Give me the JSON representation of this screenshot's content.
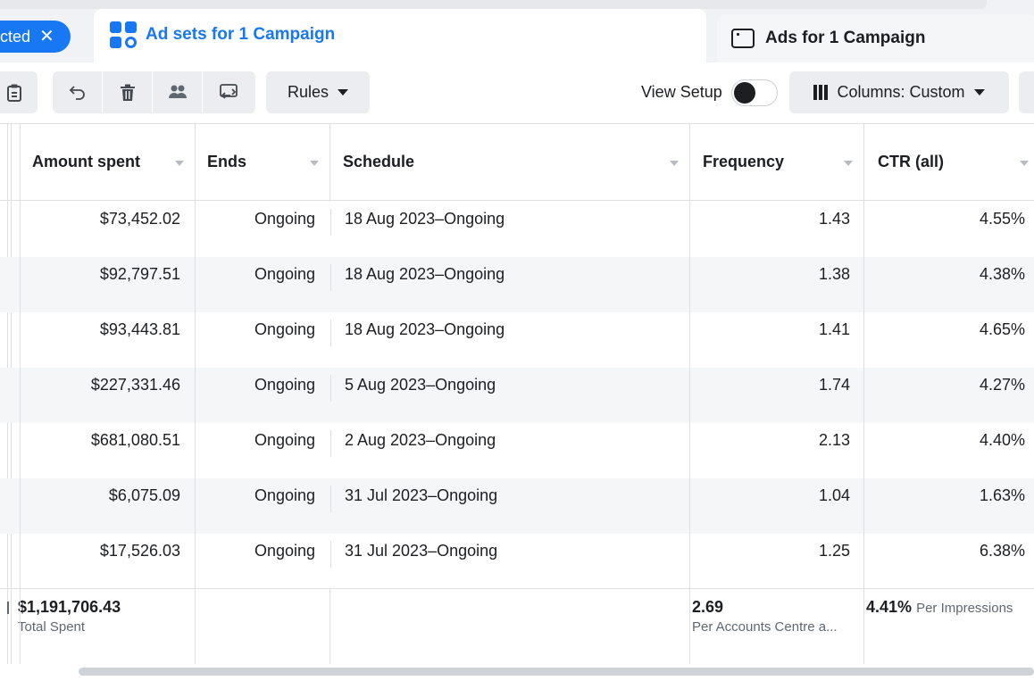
{
  "tabs": {
    "selected_pill": "cted",
    "active": "Ad sets for 1 Campaign",
    "inactive": "Ads for 1 Campaign"
  },
  "toolbar": {
    "rules_label": "Rules",
    "view_setup_label": "View Setup",
    "columns_label": "Columns: Custom"
  },
  "table": {
    "headers": {
      "amount_spent": "Amount spent",
      "ends": "Ends",
      "schedule": "Schedule",
      "frequency": "Frequency",
      "ctr": "CTR (all)"
    },
    "rows": [
      {
        "amount": "$73,452.02",
        "ends": "Ongoing",
        "schedule": "18 Aug 2023–Ongoing",
        "frequency": "1.43",
        "ctr": "4.55%"
      },
      {
        "amount": "$92,797.51",
        "ends": "Ongoing",
        "schedule": "18 Aug 2023–Ongoing",
        "frequency": "1.38",
        "ctr": "4.38%"
      },
      {
        "amount": "$93,443.81",
        "ends": "Ongoing",
        "schedule": "18 Aug 2023–Ongoing",
        "frequency": "1.41",
        "ctr": "4.65%"
      },
      {
        "amount": "$227,331.46",
        "ends": "Ongoing",
        "schedule": "5 Aug 2023–Ongoing",
        "frequency": "1.74",
        "ctr": "4.27%"
      },
      {
        "amount": "$681,080.51",
        "ends": "Ongoing",
        "schedule": "2 Aug 2023–Ongoing",
        "frequency": "2.13",
        "ctr": "4.40%"
      },
      {
        "amount": "$6,075.09",
        "ends": "Ongoing",
        "schedule": "31 Jul 2023–Ongoing",
        "frequency": "1.04",
        "ctr": "1.63%"
      },
      {
        "amount": "$17,526.03",
        "ends": "Ongoing",
        "schedule": "31 Jul 2023–Ongoing",
        "frequency": "1.25",
        "ctr": "6.38%"
      }
    ],
    "totals": {
      "amount": "$1,191,706.43",
      "amount_sub": "Total Spent",
      "frequency": "2.69",
      "frequency_sub": "Per Accounts Centre a...",
      "ctr": "4.41%",
      "ctr_sub": "Per Impressions"
    }
  },
  "colors": {
    "accent": "#1877f2",
    "button_bg": "#ebedf0",
    "row_alt": "#f5f6f7",
    "border": "#dddfe2"
  },
  "icons": [
    "close-icon",
    "ad-sets-grid-icon",
    "ads-window-icon",
    "clipboard-icon",
    "undo-icon",
    "trash-icon",
    "people-icon",
    "swap-icon",
    "caret-down-icon",
    "columns-icon"
  ]
}
